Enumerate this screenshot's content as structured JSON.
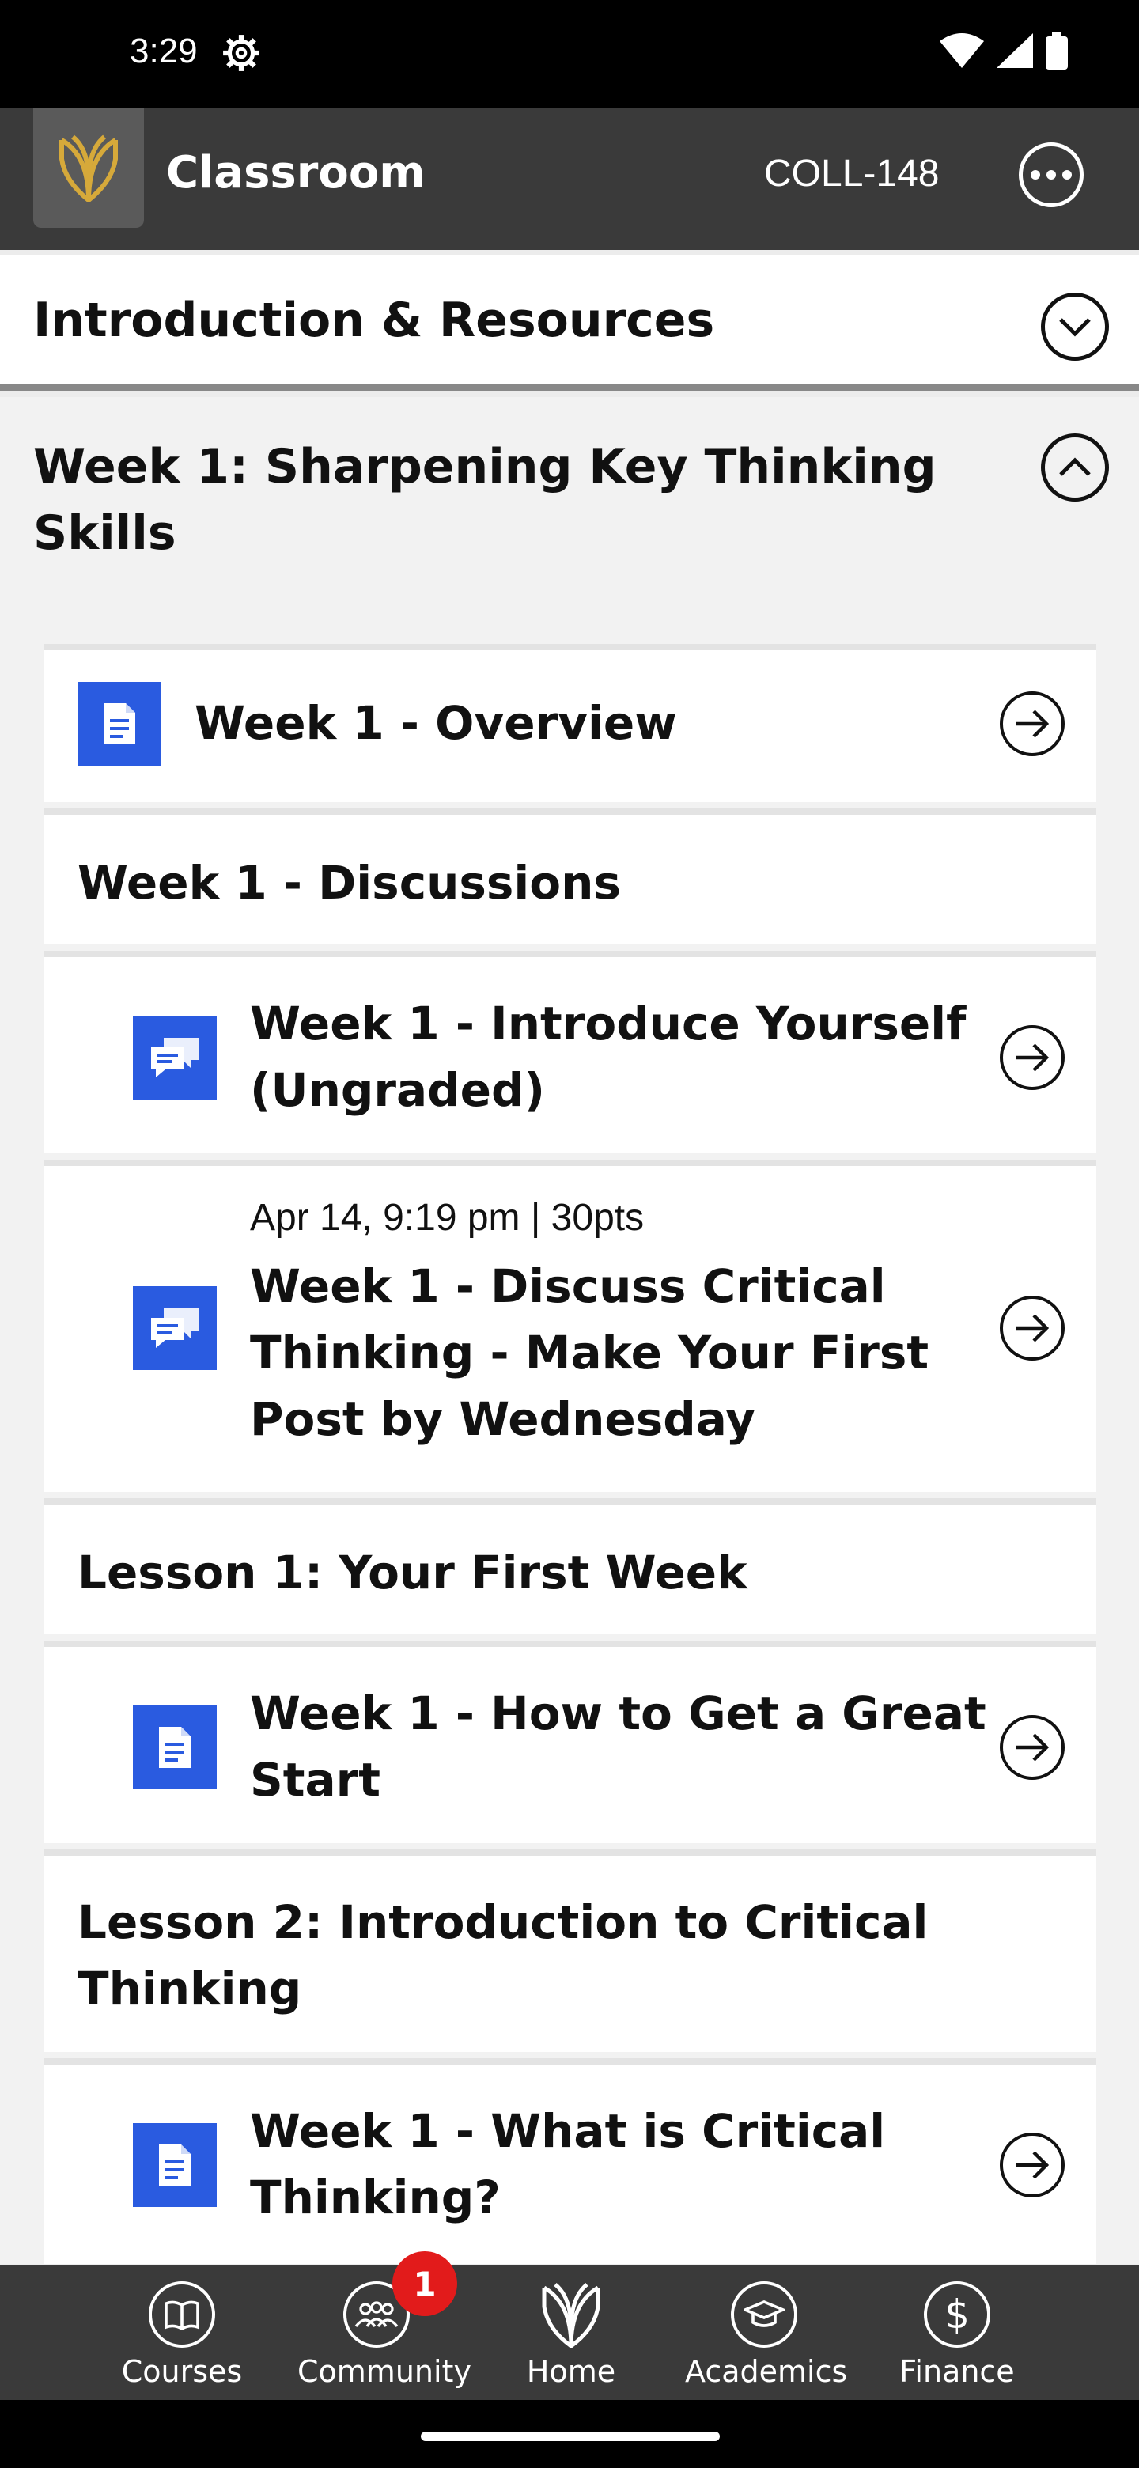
{
  "status_bar": {
    "time": "3:29"
  },
  "app_bar": {
    "title": "Classroom",
    "course_code": "COLL-148"
  },
  "sections": {
    "intro": {
      "label": "Introduction & Resources"
    },
    "week1": {
      "label": "Week 1: Sharpening Key Thinking Skills"
    }
  },
  "items": {
    "overview": {
      "label": "Week 1 - Overview"
    },
    "discussions_header": {
      "label": "Week 1 - Discussions"
    },
    "introduce": {
      "label": "Week 1 - Introduce Yourself (Ungraded)"
    },
    "discuss": {
      "meta": "Apr 14, 9:19 pm | 30pts",
      "label": "Week 1 - Discuss Critical Thinking - Make Your First Post by Wednesday"
    },
    "lesson1_header": {
      "label": "Lesson 1: Your First Week"
    },
    "great_start": {
      "label": "Week 1 - How to Get a Great Start"
    },
    "lesson2_header": {
      "label": "Lesson 2: Introduction to Critical Thinking"
    },
    "what_is": {
      "label": "Week 1 - What is Critical Thinking?"
    }
  },
  "nav": {
    "courses": "Courses",
    "community": "Community",
    "home": "Home",
    "academics": "Academics",
    "finance": "Finance",
    "community_badge": "1"
  },
  "colors": {
    "accent": "#2a5be0",
    "bar": "#3a3a3a",
    "badge": "#e21b1b",
    "logo": "#d6a93a"
  }
}
